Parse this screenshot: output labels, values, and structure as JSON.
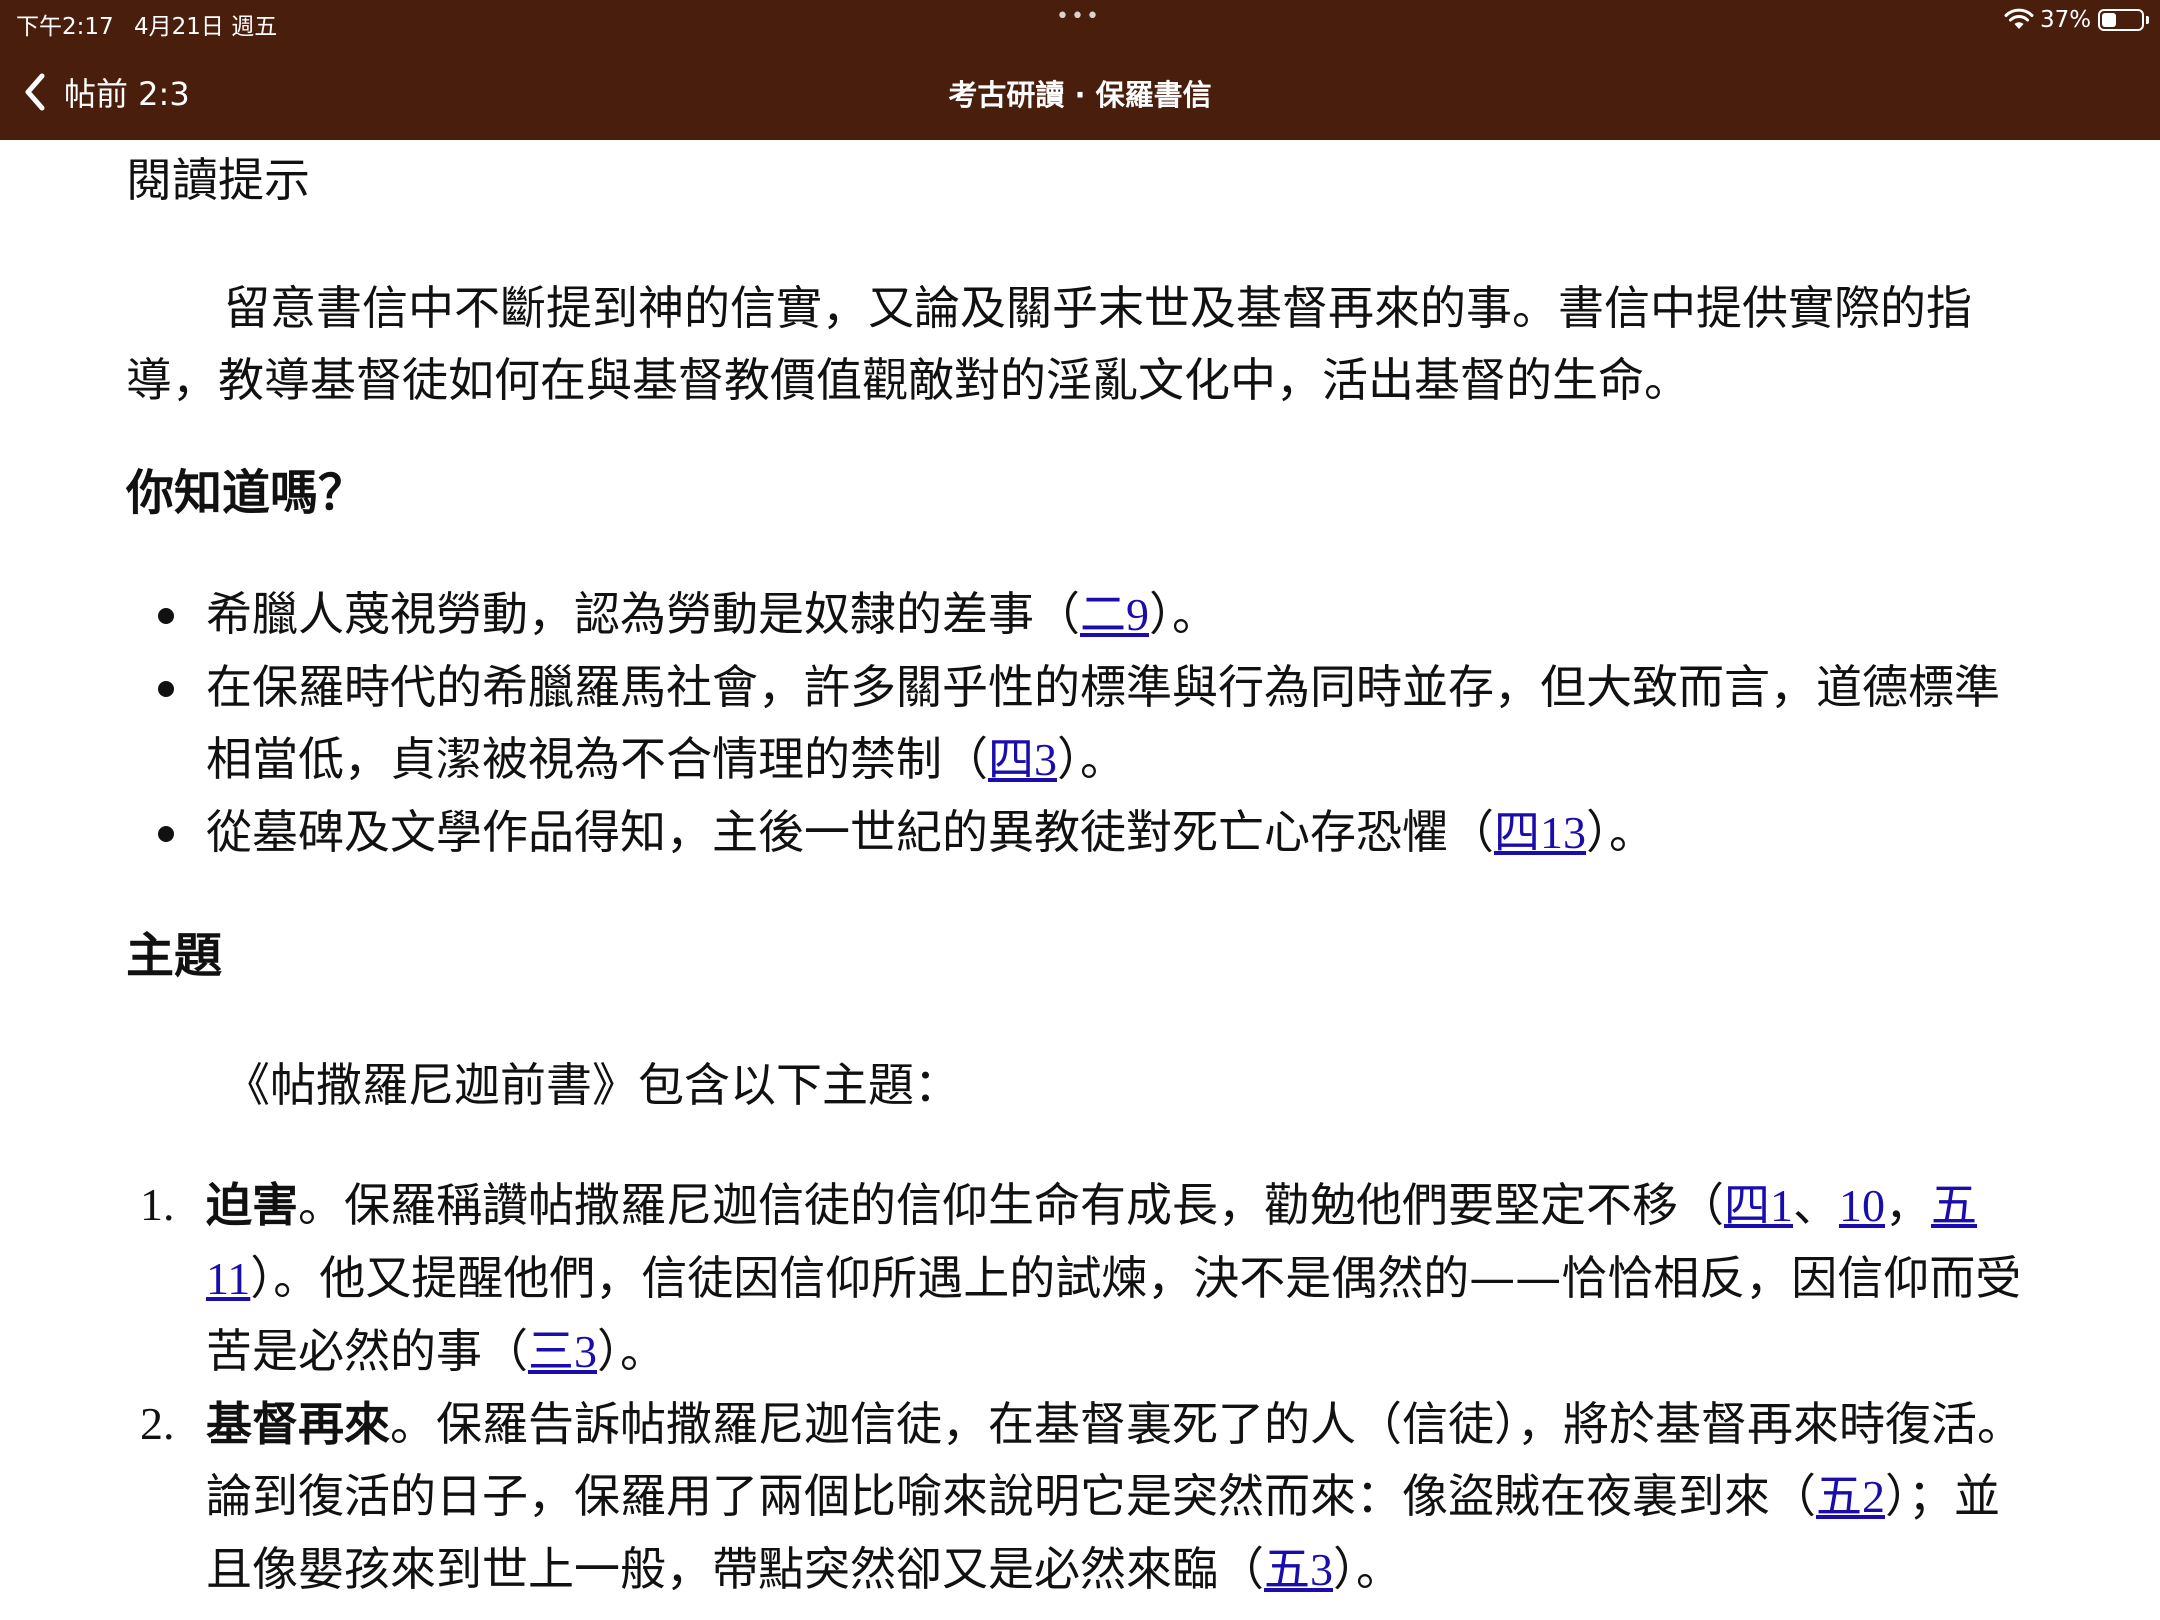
{
  "status_bar": {
    "time": "下午2:17",
    "date": "4月21日 週五",
    "dots": "•••",
    "battery_percent": "37%",
    "battery_level": 0.37
  },
  "nav": {
    "back_label": "帖前 2:3",
    "title": "考古研讀 · 保羅書信"
  },
  "content": {
    "cut_heading": "閱讀提示",
    "reading_tip": "留意書信中不斷提到神的信實，又論及關乎末世及基督再來的事。書信中提供實際的指導，教導基督徒如何在與基督教價值觀敵對的淫亂文化中，活出基督的生命。",
    "did_you_know": {
      "heading": "你知道嗎？",
      "items": [
        {
          "before": "希臘人蔑視勞動，認為勞動是奴隸的差事（",
          "ref_ch": "二",
          "ref_v": "9",
          "after": "）。"
        },
        {
          "before": "在保羅時代的希臘羅馬社會，許多關乎性的標準與行為同時並存，但大致而言，道德標準相當低，貞潔被視為不合情理的禁制（",
          "ref_ch": "四",
          "ref_v": "3",
          "after": "）。"
        },
        {
          "before": "從墓碑及文學作品得知，主後一世紀的異教徒對死亡心存恐懼（",
          "ref_ch": "四",
          "ref_v": "13",
          "after": "）。"
        }
      ]
    },
    "themes": {
      "heading": "主題",
      "intro": "《帖撒羅尼迦前書》包含以下主題：",
      "items": [
        {
          "num": "1.",
          "title": "迫害",
          "p1": "。保羅稱讚帖撒羅尼迦信徒的信仰生命有成長，勸勉他們要堅定不移（",
          "r1_ch": "四",
          "r1_v": "1",
          "s1": "、",
          "r2_v": "10",
          "s2": "，",
          "r3_ch": "五",
          "r3_v": "11",
          "p2": "）。他又提醒他們，信徒因信仰所遇上的試煉，決不是偶然的——恰恰相反，因信仰而受苦是必然的事（",
          "r4_ch": "三",
          "r4_v": "3",
          "p3": "）。"
        },
        {
          "num": "2.",
          "title": "基督再來",
          "p1": "。保羅告訴帖撒羅尼迦信徒，在基督裏死了的人（信徒），將於基督再來時復活。論到復活的日子，保羅用了兩個比喻來說明它是突然而來：像盜賊在夜裏到來（",
          "r1_ch": "五",
          "r1_v": "2",
          "p2": "）；並且像嬰孩來到世上一般，帶點突然卻又是必然來臨（",
          "r2_ch": "五",
          "r2_v": "3",
          "p3": "）。"
        }
      ]
    }
  }
}
